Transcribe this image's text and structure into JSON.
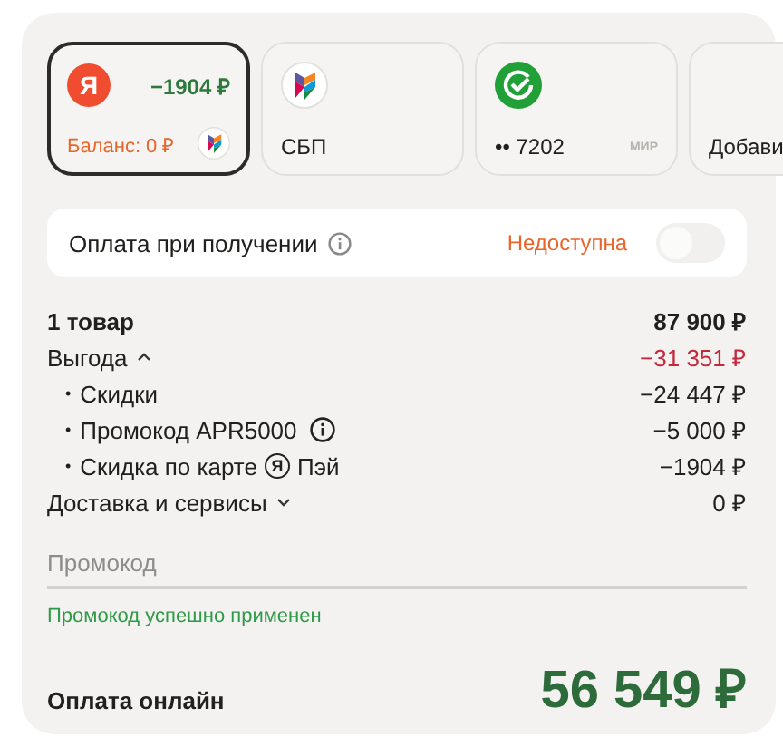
{
  "payment_methods": [
    {
      "kind": "yandex",
      "selected": true,
      "logo_letter": "Я",
      "cashback": "−1904 ₽",
      "balance": "Баланс: 0 ₽"
    },
    {
      "kind": "sbp",
      "selected": false,
      "label": "СБП"
    },
    {
      "kind": "card",
      "selected": false,
      "label": "•• 7202",
      "network": "МИР"
    },
    {
      "kind": "add",
      "selected": false,
      "label": "Добави"
    }
  ],
  "cash_on_delivery": {
    "label": "Оплата при получении",
    "status": "Недоступна",
    "on": false
  },
  "summary": [
    {
      "kind": "total",
      "label": "1 товар",
      "amount": "87 900 ₽"
    },
    {
      "kind": "group",
      "label": "Выгода",
      "expanded": true,
      "highlight": true,
      "amount": "−31 351 ₽"
    },
    {
      "kind": "sub",
      "bullet": "•",
      "label": "Скидки",
      "amount": "−24 447 ₽"
    },
    {
      "kind": "sub",
      "bullet": "•",
      "label": "Промокод APR5000",
      "info": true,
      "amount": "−5 000 ₽"
    },
    {
      "kind": "sub",
      "bullet": "•",
      "label": "Скидка по карте",
      "pay_logo": "Я",
      "suffix": "Пэй",
      "amount": "−1904 ₽"
    },
    {
      "kind": "group",
      "label": "Доставка и сервисы",
      "expanded": false,
      "highlight": false,
      "amount": "0 ₽"
    }
  ],
  "promo": {
    "placeholder": "Промокод",
    "message": "Промокод успешно применен"
  },
  "online_total": {
    "label": "Оплата онлайн",
    "amount": "56 549 ₽"
  }
}
